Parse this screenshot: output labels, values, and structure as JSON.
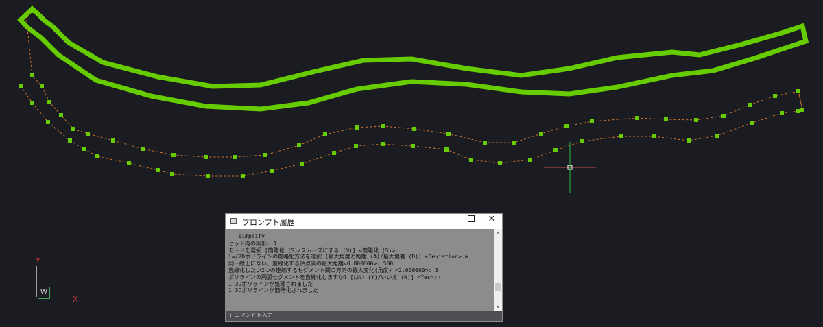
{
  "colors": {
    "background": "#1b1c21",
    "polyline_thick": "#66cc00",
    "polyline_vertex": "#66cc00",
    "polyline_dashed": "#d4772c",
    "crosshair_vertical": "#2ab83a",
    "crosshair_horizontal": "#c85050",
    "history_background": "#8c8c8c",
    "command_line_background": "#4e4f54"
  },
  "ucs": {
    "axis_y": "Y",
    "axis_x": "X",
    "world_label": "W"
  },
  "dialog": {
    "title": "プロンプト履歴",
    "icon": "window-app-icon",
    "minimize_label": "–",
    "maximize_icon": "maximize-icon",
    "close_label": "✕",
    "history": [
      ": _simplify",
      "セット内の図形: 1",
      "モードを選択 [簡略化 (S)/スムーズにする (M)] <簡略化 (S)>:",
      "lw/2Dポリラインの簡略化方法を選択 [最大角度と距離 (A)/最大偏差 (D)] <Deviation>:a",
      "同一線上にない、直線化する頂点間の最大距離<0.800000>: 500",
      "直線化したい2つの連続するセグメント間の方向の最大変化(角度) <2.000000>: 3",
      "ポリラインの円弧セグメントを直線化しますか? [はい (Y)/いいえ (N)] <Yes>:n",
      "1 3Dポリラインが処理されました",
      "1 3Dポリラインが簡略化されました",
      ":"
    ],
    "scroll_up": "∧",
    "scroll_down": "∨",
    "command_prefix": ":",
    "command_placeholder": "コマンドを入力"
  }
}
